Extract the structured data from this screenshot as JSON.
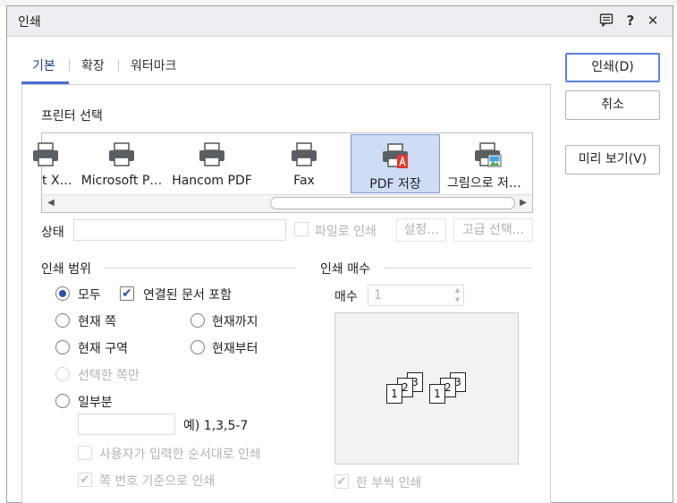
{
  "dialog": {
    "title": "인쇄",
    "title_icons": [
      "comment-icon",
      "help-icon",
      "close-icon"
    ],
    "help_glyph": "?",
    "close_glyph": "✕"
  },
  "tabs": [
    {
      "label": "기본",
      "active": true
    },
    {
      "label": "확장",
      "active": false
    },
    {
      "label": "워터마크",
      "active": false
    }
  ],
  "printer_select": {
    "label": "프린터 선택",
    "printers": [
      {
        "label": "t X…",
        "icon": "printer-icon",
        "selected": false
      },
      {
        "label": "Microsoft P…",
        "icon": "printer-icon",
        "selected": false
      },
      {
        "label": "Hancom PDF",
        "icon": "printer-icon",
        "selected": false
      },
      {
        "label": "Fax",
        "icon": "printer-icon",
        "selected": false
      },
      {
        "label": "PDF 저장",
        "icon": "pdf-printer-icon",
        "selected": true
      },
      {
        "label": "그림으로 저…",
        "icon": "image-printer-icon",
        "selected": false
      }
    ]
  },
  "status": {
    "label": "상태",
    "value": "",
    "print_to_file": "파일로 인쇄",
    "settings_button": "설정...",
    "advanced_button": "고급 선택..."
  },
  "print_range": {
    "title": "인쇄 범위",
    "all": "모두",
    "include_linked": "연결된 문서 포함",
    "current_page": "현재 쪽",
    "up_to_current": "현재까지",
    "current_section": "현재 구역",
    "from_current": "현재부터",
    "selected_pages": "선택한 쪽만",
    "partial": "일부분",
    "partial_value": "",
    "partial_example": "예) 1,3,5-7",
    "user_order": "사용자가 입력한 순서대로 인쇄",
    "page_number_based": "쪽 번호 기준으로 인쇄"
  },
  "copies": {
    "title": "인쇄 매수",
    "label": "매수",
    "value": "1",
    "collate": "한 부씩 인쇄",
    "preview_pages": [
      "1",
      "2",
      "3"
    ]
  },
  "buttons": {
    "print": "인쇄(D)",
    "cancel": "취소",
    "preview": "미리 보기(V)"
  },
  "colors": {
    "accent": "#4a6bd0",
    "selected_bg": "#cfdcf5",
    "pdf_red": "#e03a2f"
  }
}
